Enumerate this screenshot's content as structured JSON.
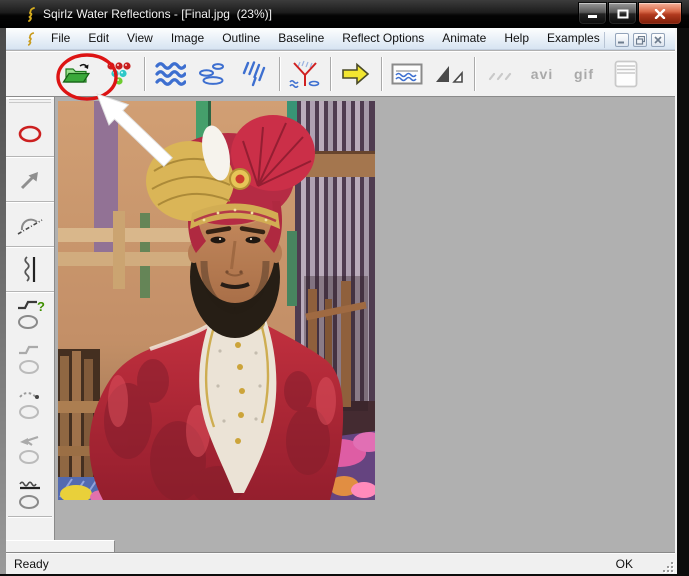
{
  "window": {
    "title": "Sqirlz Water Reflections - [Final.jpg  (23%)]"
  },
  "menu": {
    "items": [
      {
        "label": "File"
      },
      {
        "label": "Edit"
      },
      {
        "label": "View"
      },
      {
        "label": "Image"
      },
      {
        "label": "Outline"
      },
      {
        "label": "Baseline"
      },
      {
        "label": "Reflect Options"
      },
      {
        "label": "Animate"
      },
      {
        "label": "Help"
      },
      {
        "label": "Examples"
      }
    ]
  },
  "toolbar": {
    "buttons": [
      {
        "name": "open-file",
        "icon": "green-open-folder"
      },
      {
        "name": "ripple-colors",
        "icon": "color-dots"
      },
      {
        "name": "waves-ripple",
        "icon": "blue-waves"
      },
      {
        "name": "ring-ripple",
        "icon": "blue-ellipses"
      },
      {
        "name": "rain-ripple",
        "icon": "blue-diagonal-lines"
      },
      {
        "name": "combine-effects",
        "icon": "red-fork-with-waves"
      },
      {
        "name": "run-animation",
        "icon": "yellow-right-arrow"
      },
      {
        "name": "preview-image",
        "icon": "framed-waves"
      },
      {
        "name": "resize-image",
        "icon": "two-triangles"
      },
      {
        "name": "frame-dashes",
        "icon": "gray-dashes",
        "disabled": true
      },
      {
        "name": "save-avi",
        "label": "avi",
        "disabled": true
      },
      {
        "name": "save-gif",
        "label": "gif",
        "disabled": true
      },
      {
        "name": "filmstrip",
        "icon": "filmstrip-stack",
        "disabled": true
      }
    ],
    "avi_label": "avi",
    "gif_label": "gif"
  },
  "sidebar": {
    "tools": [
      {
        "name": "oval-outline-tool",
        "icon": "red-ellipse",
        "active": true
      },
      {
        "name": "arrow-tool",
        "icon": "gray-arrow-up-right"
      },
      {
        "name": "arc-tool",
        "icon": "arc-over-dash-dot-line"
      },
      {
        "name": "zigzag-tool",
        "icon": "vertical-zigzag-and-line"
      },
      {
        "name": "custom-outline-help-tool",
        "icon": "step-line-question-ellipse"
      },
      {
        "name": "step-outline-tool",
        "icon": "step-line-ellipse"
      },
      {
        "name": "dotted-curve-outline-tool",
        "icon": "dotted-curve-ellipse"
      },
      {
        "name": "bent-arrow-outline-tool",
        "icon": "bent-arrow-ellipse"
      },
      {
        "name": "wave-outline-tool",
        "icon": "wave-line-ellipse"
      }
    ],
    "help_glyph": "?"
  },
  "statusbar": {
    "ready": "Ready",
    "ok": "OK"
  },
  "annotation": {
    "shape": "red-circle-around-open-button-with-white-arrow",
    "circle_color": "#dd1414",
    "arrow_color": "#ffffff"
  },
  "document": {
    "content": "photo of a groom wearing a red and gold turban and red embroidered sherwani"
  },
  "colors": {
    "canvas_gray": "#b0b0b0",
    "menubar_tint": "#d7e4f2",
    "close_button_red": "#b13a1e",
    "toolbar_bg": "#f1f1f1"
  }
}
